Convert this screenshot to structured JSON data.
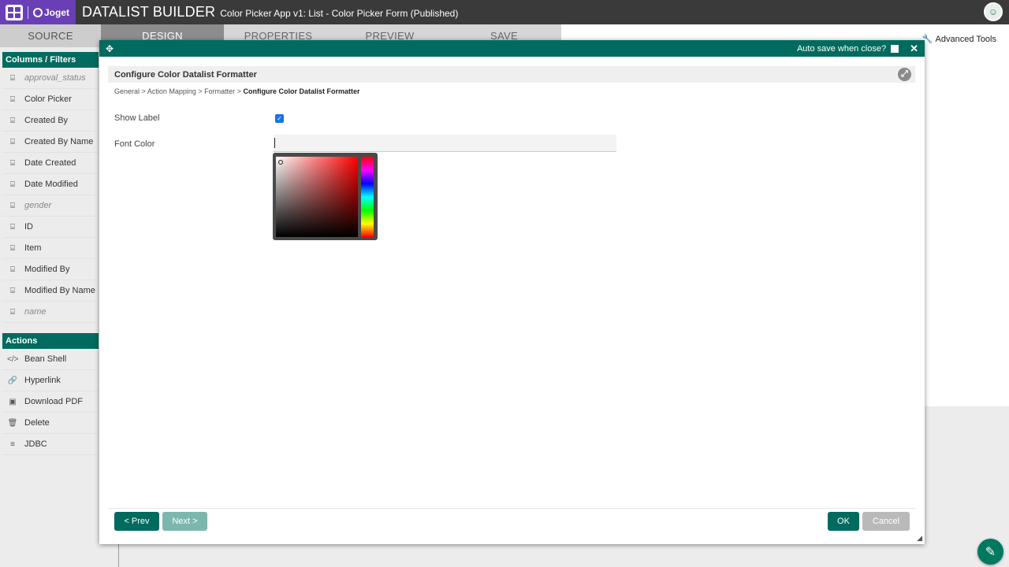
{
  "topbar": {
    "logo_text": "Joget",
    "title": "DATALIST BUILDER",
    "subtitle": "Color Picker App v1: List - Color Picker Form (Published)"
  },
  "tabs": [
    {
      "label": "SOURCE"
    },
    {
      "label": "DESIGN"
    },
    {
      "label": "PROPERTIES"
    },
    {
      "label": "PREVIEW"
    },
    {
      "label": "SAVE"
    }
  ],
  "toolbar": {
    "advanced_tools": "Advanced Tools"
  },
  "columns_panel": {
    "title": "Columns / Filters",
    "items": [
      {
        "label": "approval_status",
        "icon": "column-icon"
      },
      {
        "label": "Color Picker",
        "icon": "column-icon"
      },
      {
        "label": "Created By",
        "icon": "column-icon"
      },
      {
        "label": "Created By Name",
        "icon": "column-icon"
      },
      {
        "label": "Date Created",
        "icon": "column-icon"
      },
      {
        "label": "Date Modified",
        "icon": "column-icon"
      },
      {
        "label": "gender",
        "icon": "column-icon"
      },
      {
        "label": "ID",
        "icon": "column-icon"
      },
      {
        "label": "Item",
        "icon": "column-icon"
      },
      {
        "label": "Modified By",
        "icon": "column-icon"
      },
      {
        "label": "Modified By Name",
        "icon": "column-icon"
      },
      {
        "label": "name",
        "icon": "column-icon"
      }
    ]
  },
  "actions_panel": {
    "title": "Actions",
    "items": [
      {
        "label": "Bean Shell",
        "icon": "code-icon"
      },
      {
        "label": "Hyperlink",
        "icon": "link-icon"
      },
      {
        "label": "Download PDF",
        "icon": "pdf-icon"
      },
      {
        "label": "Delete",
        "icon": "trash-icon"
      },
      {
        "label": "JDBC",
        "icon": "database-icon"
      }
    ]
  },
  "dialog": {
    "autosave_label": "Auto save when close?",
    "header": "Configure Color Datalist Formatter",
    "breadcrumb": {
      "items": [
        "General",
        "Action Mapping",
        "Formatter"
      ],
      "separator": ">",
      "current": "Configure Color Datalist Formatter"
    },
    "show_label": "Show Label",
    "show_label_checked": true,
    "font_color_label": "Font Color",
    "font_color_value": "",
    "prev_button": "< Prev",
    "next_button": "Next >",
    "ok_button": "OK",
    "cancel_button": "Cancel"
  },
  "colors": {
    "primary": "#006b5e",
    "brand_purple": "#6a3fb5",
    "topbar": "#3a3a3a"
  }
}
